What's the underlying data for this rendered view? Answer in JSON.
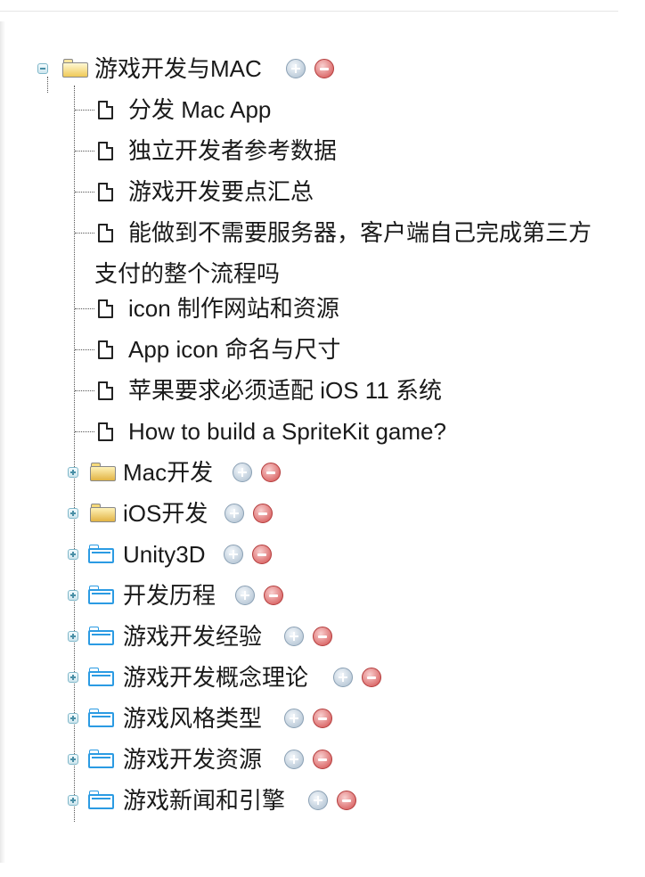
{
  "root": {
    "label": "游戏开发与MAC",
    "children": [
      {
        "label": "分发 Mac App"
      },
      {
        "label": "独立开发者参考数据"
      },
      {
        "label": "游戏开发要点汇总"
      },
      {
        "label": "能做到不需要服务器，客户端自己完成第三方支付的整个流程吗"
      },
      {
        "label": "icon 制作网站和资源"
      },
      {
        "label": "App icon 命名与尺寸"
      },
      {
        "label": "苹果要求必须适配 iOS 11 系统"
      },
      {
        "label": "How to build a SpriteKit game?"
      }
    ]
  },
  "folders": [
    {
      "label": "Mac开发",
      "icon": "yellow-folder-icon"
    },
    {
      "label": "iOS开发",
      "icon": "yellow-folder-icon"
    },
    {
      "label": "Unity3D",
      "icon": "blue-folder-icon"
    },
    {
      "label": "开发历程",
      "icon": "blue-folder-icon"
    },
    {
      "label": "游戏开发经验",
      "icon": "blue-folder-icon"
    },
    {
      "label": "游戏开发概念理论",
      "icon": "blue-folder-icon"
    },
    {
      "label": "游戏风格类型",
      "icon": "blue-folder-icon"
    },
    {
      "label": "游戏开发资源",
      "icon": "blue-folder-icon"
    },
    {
      "label": "游戏新闻和引擎",
      "icon": "blue-folder-icon"
    }
  ],
  "colors": {
    "add": "#a9bccd",
    "remove": "#d24b4b",
    "blue_folder": "#2b9be3",
    "yellow_folder": "#e2b444"
  }
}
